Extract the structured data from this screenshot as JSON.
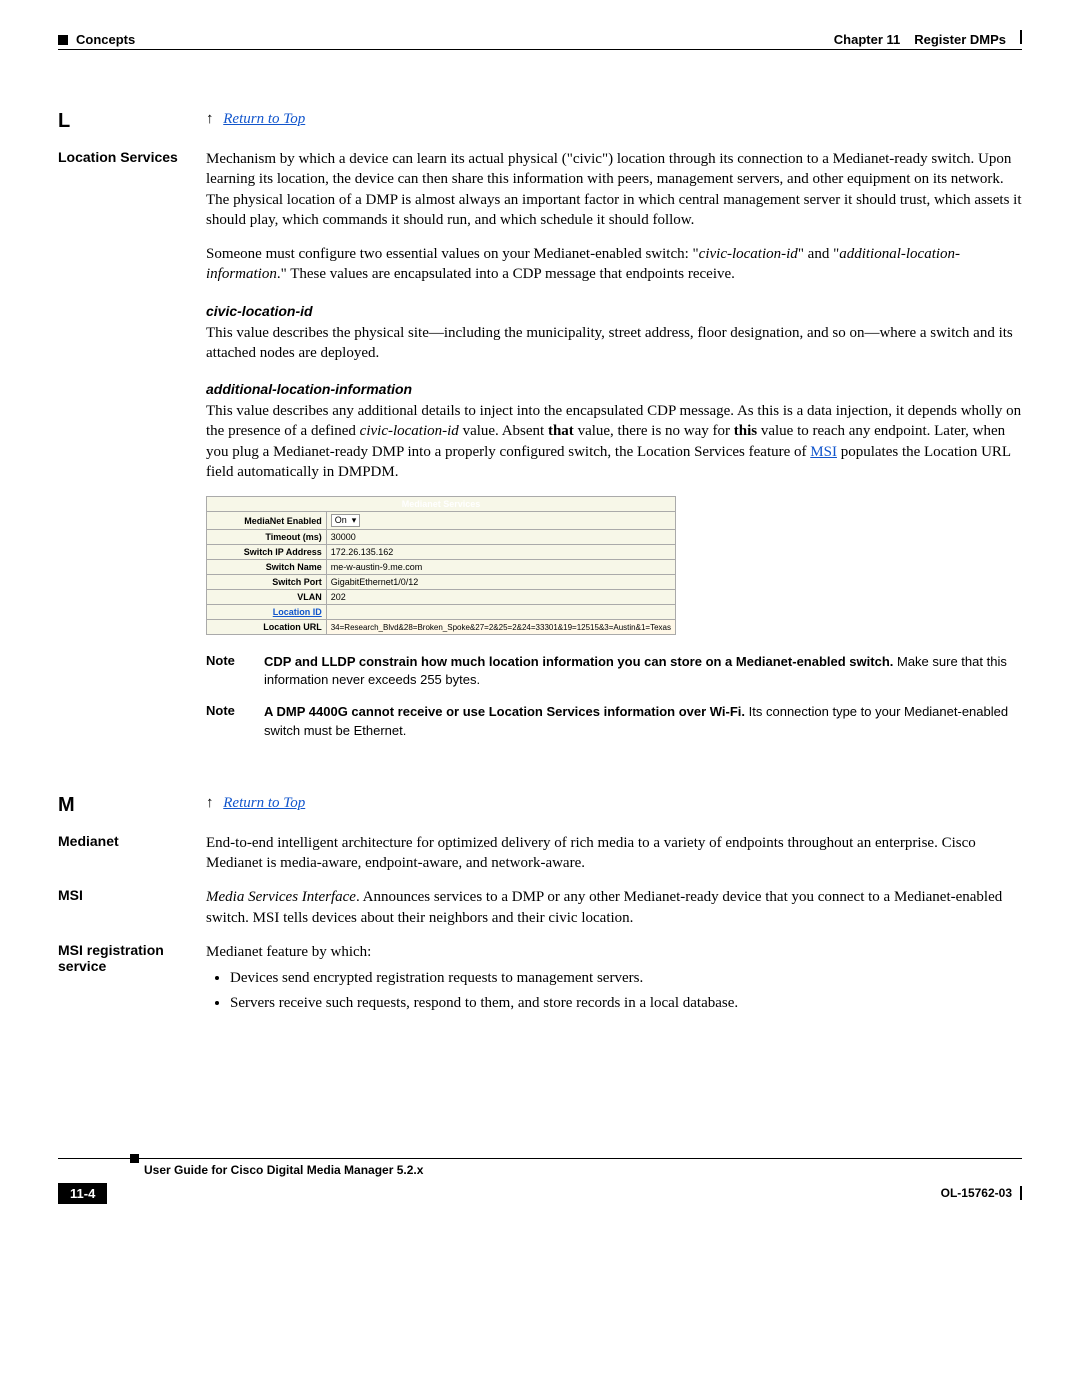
{
  "header": {
    "left_section": "Concepts",
    "right_chapter": "Chapter 11",
    "right_title": "Register DMPs"
  },
  "letterL": "L",
  "letterM": "M",
  "return_to_top": "Return to Top",
  "terms": {
    "location_services": "Location Services",
    "medianet": "Medianet",
    "msi": "MSI",
    "msi_reg": "MSI registration service"
  },
  "body": {
    "loc_p1": "Mechanism by which a device can learn its actual physical (\"civic\") location through its connection to a Medianet-ready switch. Upon learning its location, the device can then share this information with peers, management servers, and other equipment on its network. The physical location of a DMP is almost always an important factor in which central management server it should trust, which assets it should play, which commands it should run, and which schedule it should follow.",
    "loc_p2_a": "Someone must configure two essential values on your Medianet-enabled switch: \"",
    "loc_p2_b": "civic-location-id",
    "loc_p2_c": "\" and \"",
    "loc_p2_d": "additional-location-information",
    "loc_p2_e": ".\" These values are encapsulated into a CDP message that endpoints receive.",
    "civic_head": "civic-location-id",
    "civic_p": "This value describes the physical site—including the municipality, street address, floor designation, and so on—where a switch and its attached nodes are deployed.",
    "addl_head": "additional-location-information",
    "addl_p_a": "This value describes any additional details to inject into the encapsulated CDP message. As this is a data injection, it depends wholly on the presence of a defined ",
    "addl_p_b": "civic-location-id",
    "addl_p_c": " value. Absent ",
    "addl_p_d": "that",
    "addl_p_e": " value, there is no way for ",
    "addl_p_f": "this",
    "addl_p_g": " value to reach any endpoint. Later, when you plug a Medianet-ready DMP into a properly configured switch, the Location Services feature of ",
    "addl_p_h": "MSI",
    "addl_p_i": " populates the Location URL field automatically in DMPDM."
  },
  "table": {
    "title": "Medianet Services",
    "rows": [
      {
        "label": "MediaNet Enabled",
        "value": "On",
        "select": true
      },
      {
        "label": "Timeout (ms)",
        "value": "30000"
      },
      {
        "label": "Switch IP Address",
        "value": "172.26.135.162"
      },
      {
        "label": "Switch Name",
        "value": "me-w-austin-9.me.com"
      },
      {
        "label": "Switch Port",
        "value": "GigabitEthernet1/0/12"
      },
      {
        "label": "VLAN",
        "value": "202"
      },
      {
        "label": "Location ID",
        "value": "",
        "link": true
      }
    ],
    "hl_label": "Location URL",
    "hl_value": "34=Research_Blvd&28=Broken_Spoke&27=2&25=2&24=33301&19=12515&3=Austin&1=Texas"
  },
  "notes": {
    "label": "Note",
    "n1_bold": "CDP and LLDP constrain how much location information you can store on a Medianet-enabled switch.",
    "n1_rest": " Make sure that this information never exceeds 255 bytes.",
    "n2_bold": "A DMP 4400G cannot receive or use Location Services information over Wi-Fi.",
    "n2_rest": " Its connection type to your Medianet-enabled switch must be Ethernet."
  },
  "m_section": {
    "medianet_p": "End-to-end intelligent architecture for optimized delivery of rich media to a variety of endpoints throughout an enterprise. Cisco Medianet is media-aware, endpoint-aware, and network-aware.",
    "msi_p_a": "Media Services Interface",
    "msi_p_b": ". Announces services to a DMP or any other Medianet-ready device that you connect to a Medianet-enabled switch. MSI tells devices about their neighbors and their civic location.",
    "msi_reg_intro": "Medianet feature by which:",
    "bullet1": "Devices send encrypted registration requests to management servers.",
    "bullet2": "Servers receive such requests, respond to them, and store records in a local database."
  },
  "footer": {
    "guide": "User Guide for Cisco Digital Media Manager 5.2.x",
    "page": "11-4",
    "doc": "OL-15762-03"
  }
}
